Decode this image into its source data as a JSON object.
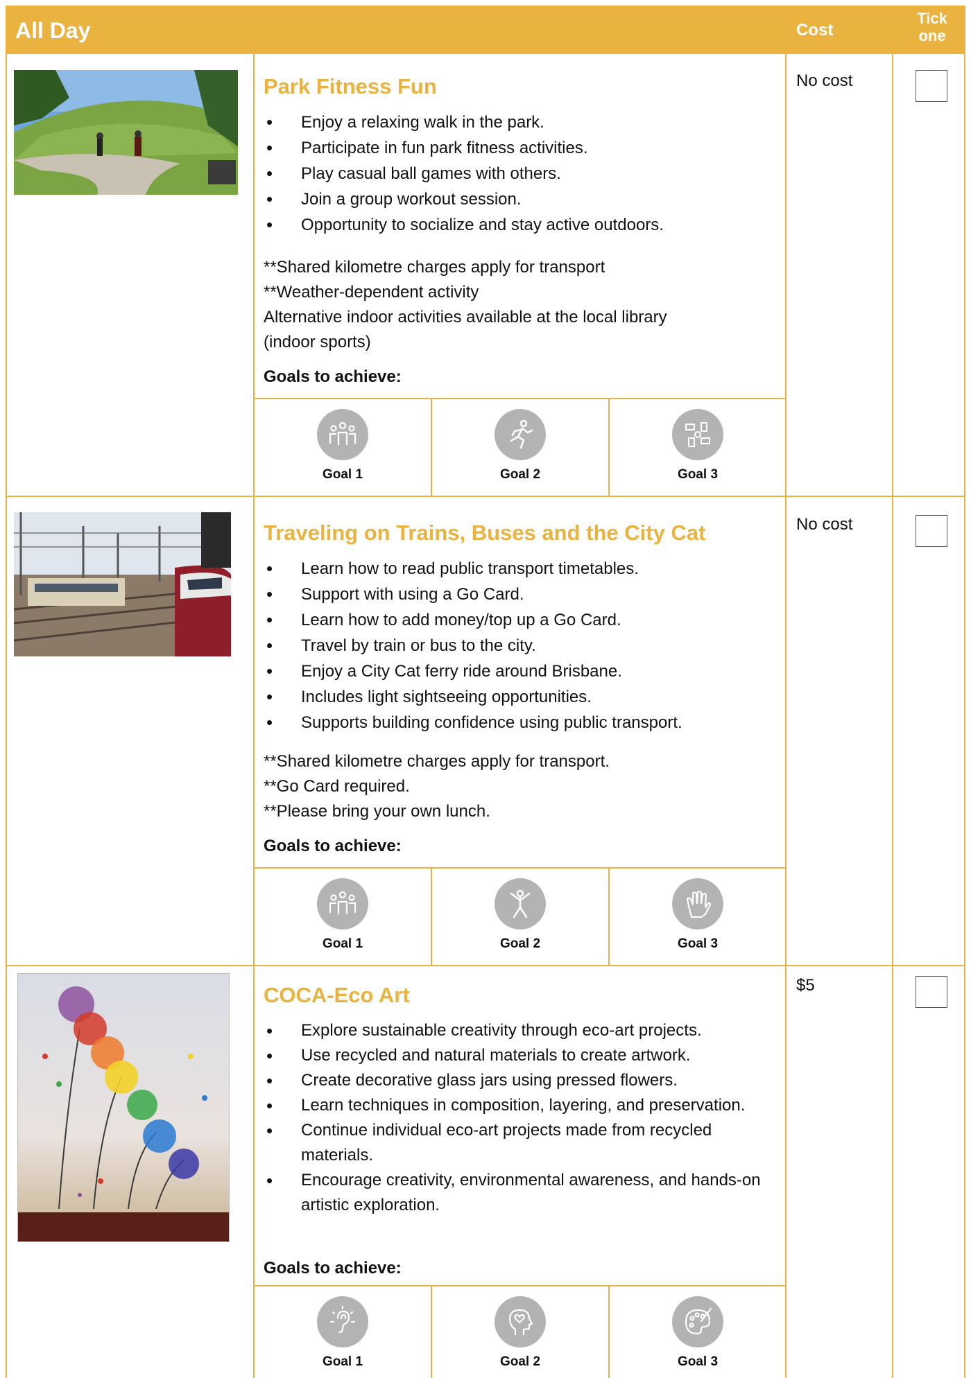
{
  "header": {
    "title": "All Day",
    "cost": "Cost",
    "tick_line1": "Tick",
    "tick_line2": "one"
  },
  "activities": [
    {
      "title": "Park Fitness Fun",
      "bullets": [
        "Enjoy a relaxing walk in the park.",
        "Participate in fun park fitness activities.",
        "Play casual ball games with others.",
        "Join a group workout session.",
        "Opportunity to socialize and stay active outdoors."
      ],
      "notes": [
        "**Shared kilometre charges apply for transport",
        "**Weather-dependent activity",
        "Alternative indoor activities available at the local library",
        "(indoor sports)"
      ],
      "goals_label": "Goals to achieve:",
      "goals": [
        {
          "label": "Goal 1",
          "icon": "group-people-icon"
        },
        {
          "label": "Goal 2",
          "icon": "running-person-icon"
        },
        {
          "label": "Goal 3",
          "icon": "teamwork-hands-icon"
        }
      ],
      "cost": "No cost"
    },
    {
      "title": "Traveling on Trains, Buses and the City Cat",
      "bullets": [
        "Learn how to read public transport timetables.",
        "Support with using a Go Card.",
        "Learn how to add money/top up a Go Card.",
        "Travel by train or bus to the city.",
        "Enjoy a City Cat ferry ride around Brisbane.",
        "Includes light sightseeing opportunities.",
        "Supports building confidence using public transport."
      ],
      "notes": [
        "**Shared kilometre charges apply for transport.",
        "**Go Card required.",
        "**Please bring your own lunch."
      ],
      "goals_label": "Goals to achieve:",
      "goals": [
        {
          "label": "Goal 1",
          "icon": "group-people-icon"
        },
        {
          "label": "Goal 2",
          "icon": "star-jump-person-icon"
        },
        {
          "label": "Goal 3",
          "icon": "raised-hand-icon"
        }
      ],
      "cost": "No cost"
    },
    {
      "title": "COCA-Eco Art",
      "bullets": [
        "Explore sustainable creativity through eco-art projects.",
        "Use recycled and natural materials to create artwork.",
        "Create decorative glass jars using pressed flowers.",
        "Learn techniques in composition, layering, and preservation.",
        "Continue individual eco-art projects made from recycled materials.",
        "Encourage creativity, environmental awareness, and hands-on artistic exploration."
      ],
      "notes": [],
      "goals_label": "Goals to achieve:",
      "goals": [
        {
          "label": "Goal 1",
          "icon": "sensory-ear-icon"
        },
        {
          "label": "Goal 2",
          "icon": "heart-head-icon"
        },
        {
          "label": "Goal 3",
          "icon": "paint-palette-icon"
        }
      ],
      "cost": "$5"
    }
  ],
  "colors": {
    "accent": "#eab23f",
    "icon_gray": "#b3b3b3"
  }
}
